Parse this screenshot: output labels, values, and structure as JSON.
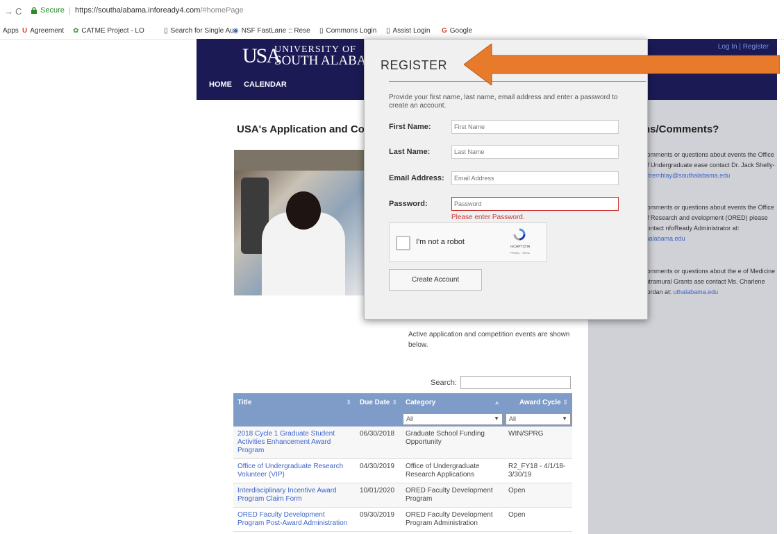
{
  "browser": {
    "secure_label": "Secure",
    "url_host": "https://southalabama.infoready4.com",
    "url_path": "/#homePage",
    "bookmarks": [
      {
        "label": "Apps",
        "icon": "apps-icon"
      },
      {
        "label": "Agreement",
        "icon": "usa-logo-icon"
      },
      {
        "label": "CATME Project - LO",
        "icon": "catme-icon"
      },
      {
        "label": "Search for Single Au",
        "icon": "page-icon"
      },
      {
        "label": "NSF FastLane :: Rese",
        "icon": "nsf-icon"
      },
      {
        "label": "Commons Login",
        "icon": "page-icon"
      },
      {
        "label": "Assist Login",
        "icon": "page-icon"
      },
      {
        "label": "Google",
        "icon": "google-icon"
      }
    ]
  },
  "header": {
    "logo_mark": "USA",
    "logo_line1": "UNIVERSITY OF",
    "logo_line2": "SOUTH ALABAM",
    "nav": [
      "HOME",
      "CALENDAR"
    ],
    "login": "Log In",
    "divider": "|",
    "register": "Register"
  },
  "main": {
    "title": "USA's Application and Cor",
    "intro": "Active application and competition events are shown below.",
    "search_label": "Search:"
  },
  "table": {
    "headers": [
      "Title",
      "Due Date",
      "Category",
      "Award Cycle"
    ],
    "filter_category": "All",
    "filter_cycle": "All",
    "rows": [
      {
        "title": "2018 Cycle 1 Graduate Student Activities Enhancement Award Program",
        "due": "06/30/2018",
        "category": "Graduate School Funding Opportunity",
        "cycle": "WIN/SPRG"
      },
      {
        "title": "Office of Undergraduate Research Volunteer (VIP)",
        "due": "04/30/2019",
        "category": "Office of Undergraduate Research Applications",
        "cycle": "R2_FY18 - 4/1/18-3/30/19"
      },
      {
        "title": "Interdisciplinary Incentive Award Program Claim Form",
        "due": "10/01/2020",
        "category": "ORED Faculty Development Program",
        "cycle": "Open"
      },
      {
        "title": "ORED Faculty Development Program Post-Award Administration",
        "due": "09/30/2019",
        "category": "ORED Faculty Development Program Administration",
        "cycle": "Open"
      }
    ]
  },
  "sidebar": {
    "title": "ns/Comments?",
    "para1": "comments or questions about events the Office of Undergraduate ease contact Dr. Jack Shelly-",
    "para1_link": "jstremblay@southalabama.edu",
    "para2": "comments or questions about events the Office of Research and evelopment (ORED) please contact nfoReady Administrator at:",
    "para2_link": "thalabama.edu",
    "para3": "comments or questions about the e of Medicine Intramural Grants ase contact Ms. Charlene Jordan at:",
    "para3_link": "uthalabama.edu"
  },
  "modal": {
    "title": "REGISTER",
    "instructions": "Provide your first name, last name, email address and enter a password to create an account.",
    "first_name_label": "First Name:",
    "first_name_placeholder": "First Name",
    "last_name_label": "Last Name:",
    "last_name_placeholder": "Last Name",
    "email_label": "Email Address:",
    "email_placeholder": "Email Address",
    "password_label": "Password:",
    "password_placeholder": "Password",
    "password_error": "Please enter Password.",
    "captcha_label": "I'm not a robot",
    "captcha_brand": "reCAPTCHA",
    "captcha_terms": "Privacy - Terms",
    "create_button": "Create Account"
  },
  "colors": {
    "header_bg": "#1c1a55",
    "arrow": "#e87a2c",
    "table_header": "#7f9cc8",
    "link": "#3e64c8",
    "error": "#cc3333"
  }
}
